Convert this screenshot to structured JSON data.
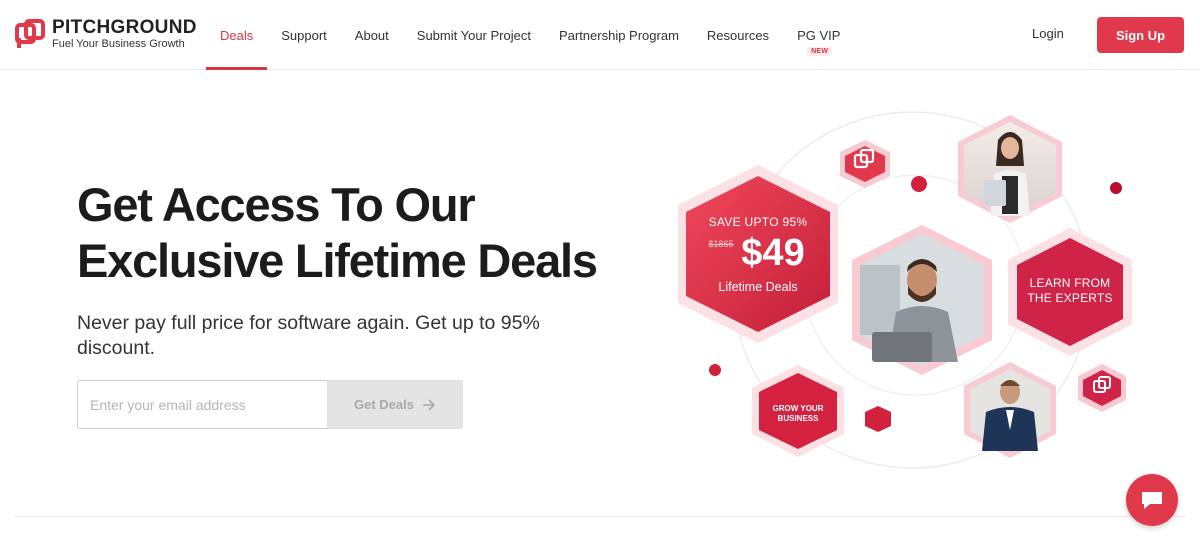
{
  "brand": {
    "name": "PITCHGROUND",
    "tagline": "Fuel Your Business Growth",
    "accent": "#e0394b"
  },
  "nav": {
    "items": [
      {
        "label": "Deals",
        "active": true
      },
      {
        "label": "Support"
      },
      {
        "label": "About"
      },
      {
        "label": "Submit Your Project"
      },
      {
        "label": "Partnership Program"
      },
      {
        "label": "Resources"
      },
      {
        "label": "PG VIP",
        "badge": "NEW"
      }
    ],
    "login_label": "Login",
    "signup_label": "Sign Up"
  },
  "hero": {
    "title_line1": "Get Access To Our",
    "title_line2": "Exclusive Lifetime Deals",
    "subtitle": "Never pay full price for software again. Get up to 95% discount.",
    "email_placeholder": "Enter your email address",
    "cta_label": "Get Deals"
  },
  "illustration": {
    "save_text": "SAVE UPTO 95%",
    "old_price": "$1865",
    "price": "$49",
    "price_caption": "Lifetime Deals",
    "learn_line1": "LEARN FROM",
    "learn_line2": "THE EXPERTS",
    "grow_line1": "GROW YOUR",
    "grow_line2": "BUSINESS"
  },
  "icons": {
    "chat": "chat-bubble-icon",
    "arrow": "arrow-right-icon",
    "logo": "pitchground-logo-icon"
  }
}
